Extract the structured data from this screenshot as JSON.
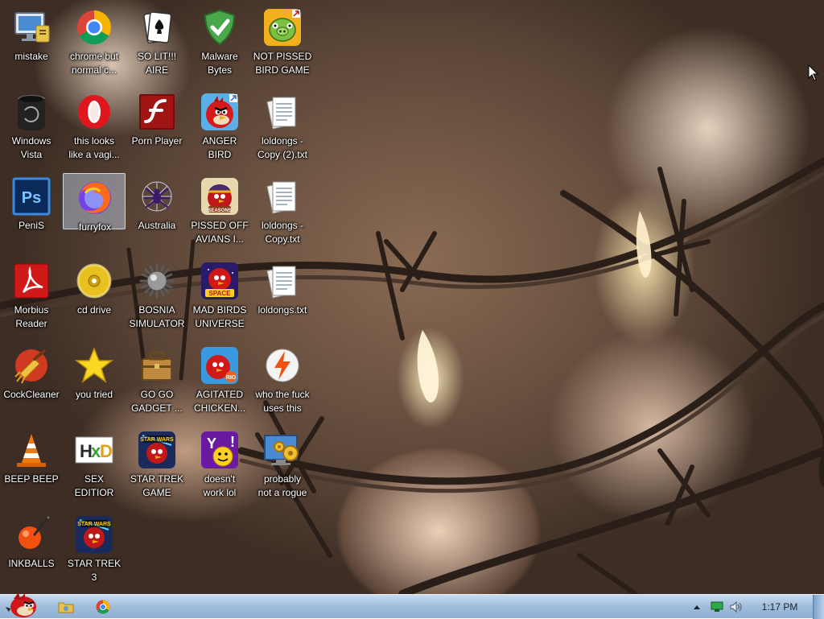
{
  "desktop": {
    "icons": [
      {
        "label": "mistake",
        "icon": "computer-monitor-icon"
      },
      {
        "label": "chrome but\nnormal c...",
        "icon": "chrome-icon"
      },
      {
        "label": "SO LIT!!!\nAIRE",
        "icon": "playing-card-icon"
      },
      {
        "label": "Malware\nBytes",
        "icon": "shield-check-icon"
      },
      {
        "label": "NOT PISSED\nBIRD GAME",
        "icon": "green-pig-icon"
      },
      {
        "label": "Windows\nVista",
        "icon": "dark-cylinder-icon"
      },
      {
        "label": "this looks\nlike a vagi...",
        "icon": "opera-icon"
      },
      {
        "label": "Porn Player",
        "icon": "flash-icon"
      },
      {
        "label": "ANGER\nBIRD",
        "icon": "red-bird-icon"
      },
      {
        "label": "loldongs -\nCopy (2).txt",
        "icon": "text-document-icon"
      },
      {
        "label": "PeniS",
        "icon": "photoshop-icon"
      },
      {
        "label": "furryfox",
        "icon": "firefox-icon"
      },
      {
        "label": "Australia",
        "icon": "spider-icon"
      },
      {
        "label": "PISSED OFF\nAVIANS I...",
        "icon": "seasons-bird-icon"
      },
      {
        "label": "loldongs -\nCopy.txt",
        "icon": "text-document-icon"
      },
      {
        "label": "Morbius\nReader",
        "icon": "pdf-reader-icon"
      },
      {
        "label": "cd drive",
        "icon": "cd-disc-icon"
      },
      {
        "label": "BOSNIA\nSIMULATOR",
        "icon": "spiked-ball-icon"
      },
      {
        "label": "MAD BIRDS\nUNIVERSE",
        "icon": "space-bird-icon"
      },
      {
        "label": "loldongs.txt",
        "icon": "text-document-icon"
      },
      {
        "label": "CockCleaner",
        "icon": "broom-cleaner-icon"
      },
      {
        "label": "you tried",
        "icon": "star-icon"
      },
      {
        "label": "GO GO\nGADGET ...",
        "icon": "toolbox-icon"
      },
      {
        "label": "AGITATED\nCHICKEN...",
        "icon": "rio-bird-icon"
      },
      {
        "label": "who the fuck\nuses this",
        "icon": "lightning-icon"
      },
      {
        "label": "BEEP BEEP",
        "icon": "traffic-cone-icon"
      },
      {
        "label": "SEX\nEDITIOR",
        "icon": "hxd-editor-icon"
      },
      {
        "label": "STAR TREK\nGAME",
        "icon": "star-wars-bird-icon"
      },
      {
        "label": "doesn't\nwork lol",
        "icon": "yahoo-messenger-icon"
      },
      {
        "label": "probably\nnot a rogue",
        "icon": "gear-monitor-icon"
      },
      {
        "label": "INKBALLS",
        "icon": "ink-ball-icon"
      },
      {
        "label": "STAR TREK\n3",
        "icon": "star-wars-bird-icon"
      }
    ]
  },
  "taskbar": {
    "start_icon": "angry-bird-start-icon",
    "pinned": [
      "folder-icon",
      "chrome-icon"
    ],
    "tray": {
      "chevron": "show-hidden-icons",
      "network": "network-icon",
      "volume": "speaker-icon",
      "time": "1:17 PM"
    }
  },
  "colors": {
    "taskbar": "#9fbcda",
    "label_text": "#ffffff"
  }
}
